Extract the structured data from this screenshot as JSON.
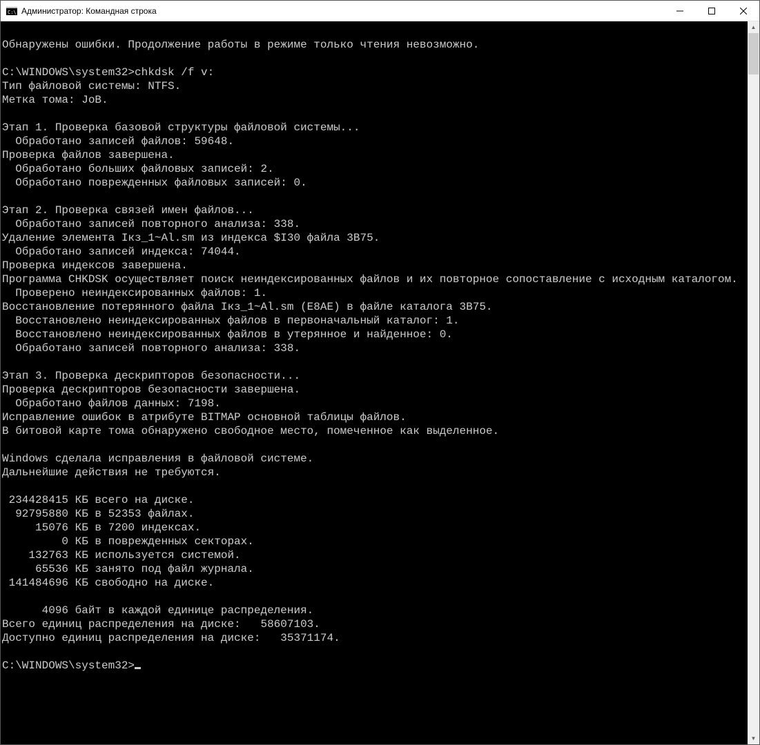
{
  "window": {
    "title": "Администратор: Командная строка"
  },
  "terminal": {
    "lines": [
      "",
      "Обнаружены ошибки. Продолжение работы в режиме только чтения невозможно.",
      "",
      "C:\\WINDOWS\\system32>chkdsk /f v:",
      "Тип файловой системы: NTFS.",
      "Метка тома: JoB.",
      "",
      "Этап 1. Проверка базовой структуры файловой системы...",
      "  Обработано записей файлов: 59648.",
      "Проверка файлов завершена.",
      "  Обработано больших файловых записей: 2.",
      "  Обработано поврежденных файловых записей: 0.",
      "",
      "Этап 2. Проверка связей имен файлов...",
      "  Обработано записей повторного анализа: 338.",
      "Удаление элемента Iкз_1~Al.sm из индекса $I30 файла 3B75.",
      "  Обработано записей индекса: 74044.",
      "Проверка индексов завершена.",
      "Программа CHKDSK осуществляет поиск неиндексированных файлов и их повторное сопоставление с исходным каталогом.",
      "  Проверено неиндексированных файлов: 1.",
      "Восстановление потерянного файла Iкз_1~Al.sm (E8AE) в файле каталога 3B75.",
      "  Восстановлено неиндексированных файлов в первоначальный каталог: 1.",
      "  Восстановлено неиндексированных файлов в утерянное и найденное: 0.",
      "  Обработано записей повторного анализа: 338.",
      "",
      "Этап 3. Проверка дескрипторов безопасности...",
      "Проверка дескрипторов безопасности завершена.",
      "  Обработано файлов данных: 7198.",
      "Исправление ошибок в атрибуте BITMAP основной таблицы файлов.",
      "В битовой карте тома обнаружено свободное место, помеченное как выделенное.",
      "",
      "Windows сделала исправления в файловой системе.",
      "Дальнейшие действия не требуются.",
      "",
      " 234428415 КБ всего на диске.",
      "  92795880 КБ в 52353 файлах.",
      "     15076 КБ в 7200 индексах.",
      "         0 КБ в поврежденных секторах.",
      "    132763 КБ используется системой.",
      "     65536 КБ занято под файл журнала.",
      " 141484696 КБ свободно на диске.",
      "",
      "      4096 байт в каждой единице распределения.",
      "Всего единиц распределения на диске:   58607103.",
      "Доступно единиц распределения на диске:   35371174.",
      "",
      "C:\\WINDOWS\\system32>"
    ]
  }
}
